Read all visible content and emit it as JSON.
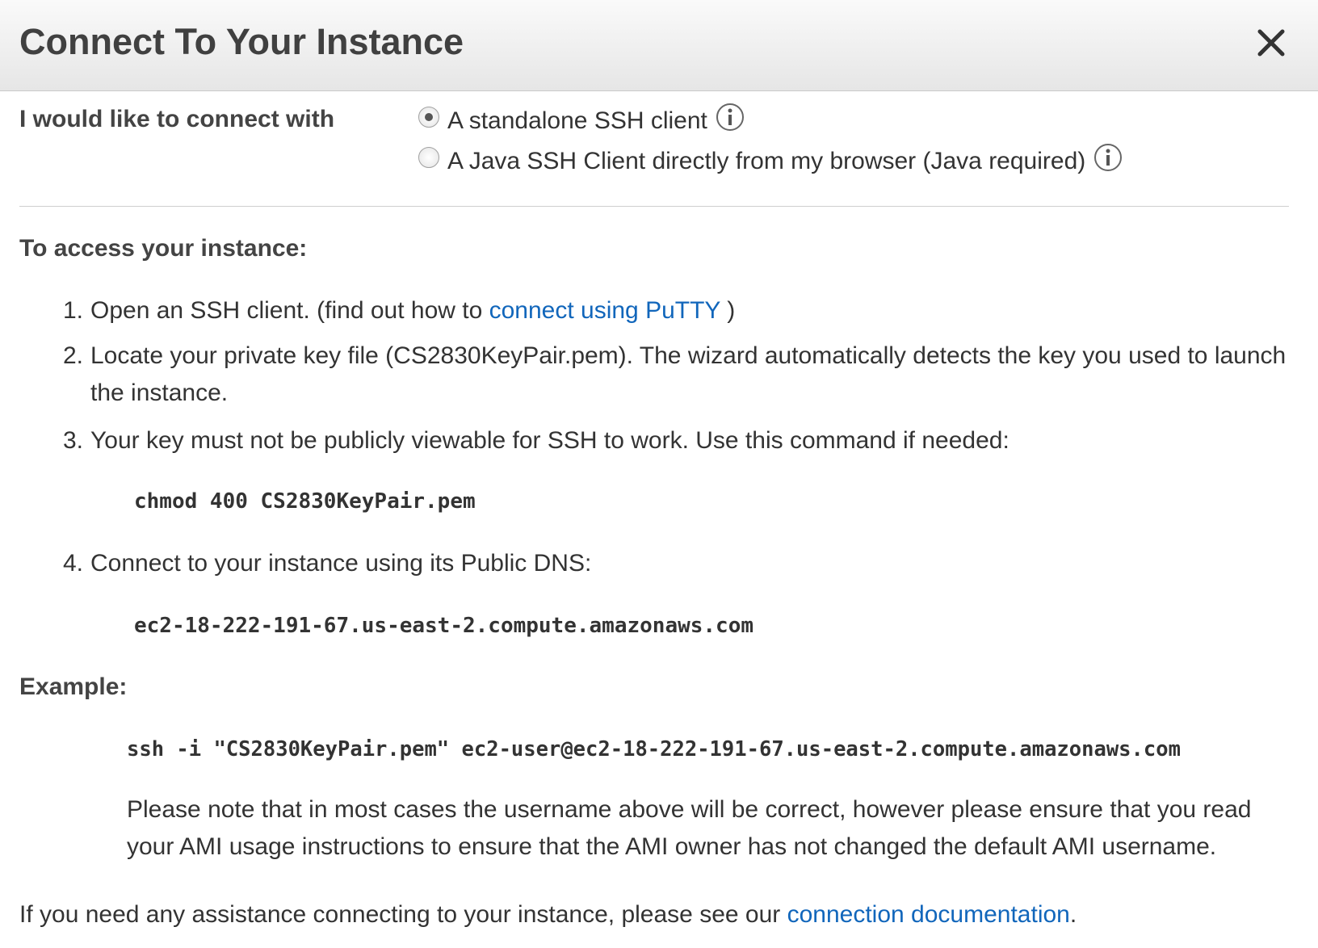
{
  "dialog": {
    "title": "Connect To Your Instance",
    "close_icon": "close-x-icon"
  },
  "connect_with": {
    "label": "I would like to connect with",
    "options": [
      {
        "label": "A standalone SSH client",
        "selected": true,
        "info_icon": "info-icon"
      },
      {
        "label": "A Java SSH Client directly from my browser (Java required)",
        "selected": false,
        "info_icon": "info-icon"
      }
    ]
  },
  "access": {
    "heading": "To access your instance:",
    "steps": [
      {
        "number": "1.",
        "text": "Open an SSH client. (find out how to ",
        "link": "connect using PuTTY",
        "suffix": " )"
      },
      {
        "number": "2.",
        "text": "Locate your private key file (CS2830KeyPair.pem). The wizard automatically detects the key you used to launch the instance."
      },
      {
        "number": "3.",
        "text": "Your key must not be publicly viewable for SSH to work. Use this command if needed:"
      },
      {
        "number": "4.",
        "text": "Connect to your instance using its Public DNS:"
      }
    ],
    "chmod_command": "chmod 400 CS2830KeyPair.pem",
    "public_dns": "ec2-18-222-191-67.us-east-2.compute.amazonaws.com"
  },
  "example": {
    "heading": "Example:",
    "command": "ssh -i \"CS2830KeyPair.pem\" ec2-user@ec2-18-222-191-67.us-east-2.compute.amazonaws.com",
    "note": "Please note that in most cases the username above will be correct, however please ensure that you read your AMI usage instructions to ensure that the AMI owner has not changed the default AMI username."
  },
  "footer": {
    "text": "If you need any assistance connecting to your instance, please see our ",
    "link": "connection documentation",
    "suffix": "."
  },
  "colors": {
    "link": "#1166bb",
    "text": "#333333",
    "header_top": "#fafafa",
    "header_bottom": "#e6e6e6"
  }
}
